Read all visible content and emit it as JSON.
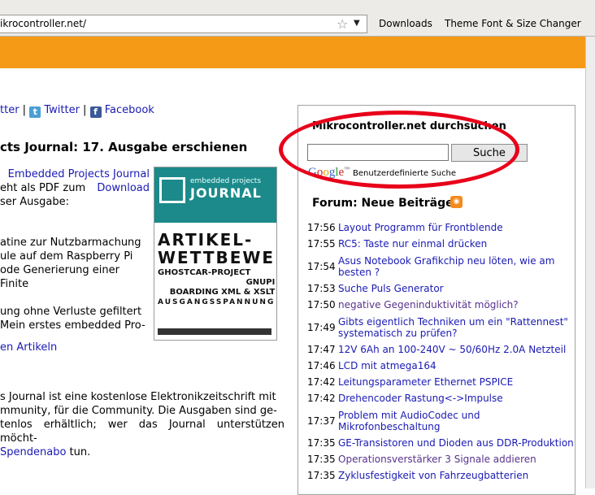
{
  "browser": {
    "url_visible": "ikrocontroller.net/",
    "bookmarks": [
      "Downloads",
      "Theme Font & Size Changer"
    ]
  },
  "colors": {
    "header": "#f59a17",
    "link": "#1a1ab4",
    "highlight": "#e8001a"
  },
  "left": {
    "social_twitter_a": "tter",
    "social_twitter_b": "Twitter",
    "social_facebook": "Facebook",
    "headline": "cts Journal: 17. Ausgabe erschienen",
    "intro_link": "Embedded Projects Journal",
    "intro_text_1": "eht als PDF zum",
    "download_link": "Download",
    "intro_text_2": "ser Ausgabe:",
    "topics": [
      "atine zur Nutzbarmachung",
      "ule auf dem Raspberry Pi",
      "ode Generierung einer Finite",
      "",
      "ung ohne Verluste gefiltert",
      "Mein erstes embedded Pro-"
    ],
    "more_link": "en Artikeln",
    "about_1": "s Journal ist eine kostenlose Elektronikzeitschrift mit",
    "about_2": "mmunity, für die Community. Die Ausgaben sind ge-",
    "about_3": "tenlos erhältlich; wer das Journal unterstützen möcht-",
    "about_link": "Spendenabo",
    "about_4": " tun."
  },
  "magazine": {
    "brand_small": "embedded projects",
    "brand_big": "JOURNAL",
    "headline_1": "ARTIKEL-",
    "headline_2": "WETTBEWERB:",
    "line_1": "GHOSTCAR-PROJECT",
    "line_2": "GNUPI",
    "line_3": "BOARDING      XML & XSLT",
    "line_4": "AUSGANGSSPANNUNG"
  },
  "search": {
    "title": "Mikrocontroller.net durchsuchen",
    "button": "Suche",
    "value": "",
    "google_caption": "Benutzerdefinierte Suche"
  },
  "forum": {
    "title": "Forum: Neue Beiträge",
    "posts": [
      {
        "time": "17:56",
        "title": "Layout Programm für Frontblende"
      },
      {
        "time": "17:55",
        "title": "RC5: Taste nur einmal drücken"
      },
      {
        "time": "17:54",
        "title": "Asus Notebook Grafikchip neu löten, wie am besten ?"
      },
      {
        "time": "17:53",
        "title": "Suche Puls Generator"
      },
      {
        "time": "17:50",
        "title": "negative Gegeninduktivität möglich?"
      },
      {
        "time": "17:49",
        "title": "Gibts eigentlich Techniken um ein \"Rattennest\" systematisch zu prüfen?"
      },
      {
        "time": "17:47",
        "title": "12V 6Ah an 100-240V ~ 50/60Hz 2.0A Netzteil"
      },
      {
        "time": "17:46",
        "title": "LCD mit atmega164"
      },
      {
        "time": "17:42",
        "title": "Leitungsparameter Ethernet PSPICE"
      },
      {
        "time": "17:42",
        "title": "Drehencoder Rastung<->Impulse"
      },
      {
        "time": "17:37",
        "title": "Problem mit AudioCodec und Mikrofonbeschaltung"
      },
      {
        "time": "17:35",
        "title": "GE-Transistoren und Dioden aus DDR-Produktion"
      },
      {
        "time": "17:35",
        "title": "Operationsverstärker 3 Signale addieren"
      },
      {
        "time": "17:35",
        "title": "Zyklusfestigkeit von Fahrzeugbatterien"
      }
    ]
  }
}
